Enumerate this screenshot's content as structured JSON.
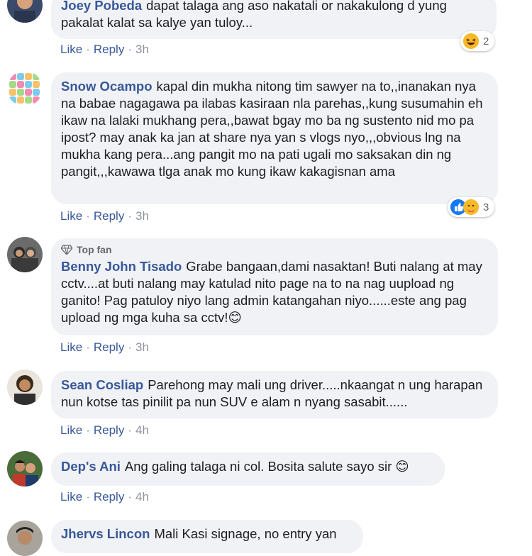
{
  "action_labels": {
    "like": "Like",
    "reply": "Reply",
    "sep": "·"
  },
  "colors": {
    "link": "#385898",
    "bubble": "#f0f2f5",
    "meta": "#8d949e"
  },
  "comments": [
    {
      "author": "Joey Pobeda",
      "text": "dapat talaga ang aso nakatali or nakakulong d yung pakalat kalat sa kalye yan tuloy...",
      "time": "3h",
      "reactions": {
        "icons": [
          "laugh-emoji"
        ],
        "count": "2"
      }
    },
    {
      "author": "Snow Ocampo",
      "text": "kapal din mukha nitong tim sawyer na to,,inanakan nya na babae nagagawa pa ilabas kasiraan nla parehas,,kung susumahin eh ikaw na lalaki mukhang pera,,bawat bgay mo ba ng sustento nid mo pa ipost? may anak ka jan at share nya yan s vlogs nyo,,,obvious lng na mukha kang pera...ang pangit mo na pati ugali mo saksakan din ng pangit,,,kawawa tlga anak mo kung ikaw kakagisnan ama",
      "time": "3h",
      "reactions": {
        "icons": [
          "like-emoji",
          "care-emoji"
        ],
        "count": "3"
      }
    },
    {
      "badge": "Top fan",
      "author": "Benny John Tisado",
      "text": "Grabe bangaan,dami nasaktan! Buti nalang at may cctv....at buti nalang may katulad nito page na to na nag uupload ng ganito! Pag patuloy niyo lang admin katangahan niyo......este ang pag upload ng mga kuha sa cctv!😊",
      "time": "3h"
    },
    {
      "author": "Sean Cosliap",
      "text": "Parehong may mali ung driver.....nkaangat n ung harapan nun kotse tas pinilit pa nun SUV e alam n nyang sasabit......",
      "time": "4h"
    },
    {
      "author": "Dep's Ani",
      "text": "Ang galing talaga ni col. Bosita salute sayo sir 😊",
      "time": "4h"
    },
    {
      "author": "Jhervs Lincon",
      "text": "Mali Kasi signage, no entry yan"
    }
  ]
}
